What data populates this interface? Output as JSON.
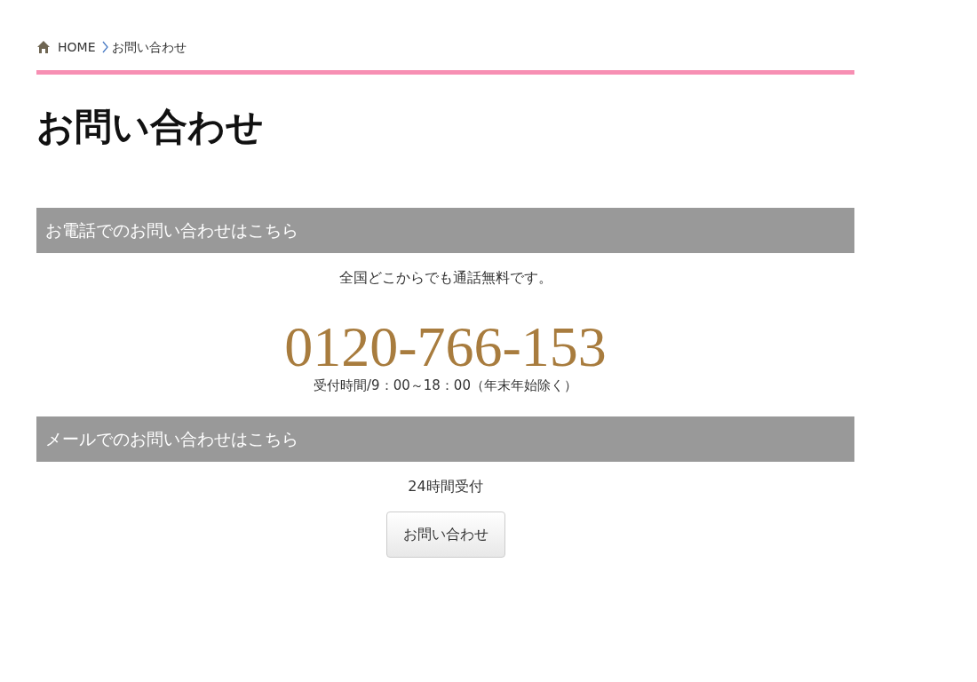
{
  "breadcrumb": {
    "home": "HOME",
    "current": "お問い合わせ"
  },
  "page_title": "お問い合わせ",
  "sections": [
    {
      "kind": "phone",
      "heading": "お電話でのお問い合わせはこちら",
      "note": "全国どこからでも通話無料です。",
      "phone": "0120-766-153",
      "hours": "受付時間/9：00～18：00（年末年始除く）"
    },
    {
      "kind": "mail",
      "heading": "メールでのお問い合わせはこちら",
      "note": "24時間受付",
      "button": "お問い合わせ"
    }
  ]
}
